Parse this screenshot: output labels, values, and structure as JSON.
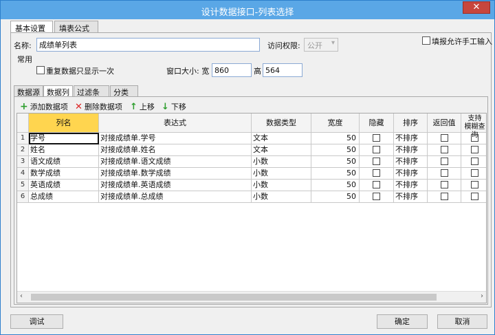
{
  "window": {
    "title": "设计数据接口-列表选择",
    "close": "✕"
  },
  "outer_tabs": [
    "基本设置",
    "填表公式"
  ],
  "form": {
    "name_label": "名称:",
    "name_value": "成绩单列表",
    "access_label": "访问权限:",
    "access_value": "公开",
    "allow_manual_label": "填报允许手工输入",
    "section_common": "常用",
    "repeat_once_label": "重复数据只显示一次",
    "window_size_label": "窗口大小: 宽",
    "width_value": "860",
    "height_label": "高",
    "height_value": "564"
  },
  "inner_tabs": [
    "数据源",
    "数据列",
    "过滤条件",
    "分类树"
  ],
  "toolbar": {
    "add": "添加数据项",
    "delete": "删除数据项",
    "up": "上移",
    "down": "下移"
  },
  "grid": {
    "headers": [
      "列名",
      "表达式",
      "数据类型",
      "宽度",
      "隐藏",
      "排序",
      "返回值"
    ],
    "header_last_line1": "支持",
    "header_last_line2": "模糊查询",
    "rows": [
      {
        "n": "1",
        "name": "学号",
        "expr": "对接成绩单.学号",
        "type": "文本",
        "width": "50",
        "sort": "不排序"
      },
      {
        "n": "2",
        "name": "姓名",
        "expr": "对接成绩单.姓名",
        "type": "文本",
        "width": "50",
        "sort": "不排序"
      },
      {
        "n": "3",
        "name": "语文成绩",
        "expr": "对接成绩单.语文成绩",
        "type": "小数",
        "width": "50",
        "sort": "不排序"
      },
      {
        "n": "4",
        "name": "数学成绩",
        "expr": "对接成绩单.数学成绩",
        "type": "小数",
        "width": "50",
        "sort": "不排序"
      },
      {
        "n": "5",
        "name": "英语成绩",
        "expr": "对接成绩单.英语成绩",
        "type": "小数",
        "width": "50",
        "sort": "不排序"
      },
      {
        "n": "6",
        "name": "总成绩",
        "expr": "对接成绩单.总成绩",
        "type": "小数",
        "width": "50",
        "sort": "不排序"
      }
    ]
  },
  "buttons": {
    "debug": "调试",
    "ok": "确定",
    "cancel": "取消"
  },
  "colors": {
    "titlebar": "#5aa7e6",
    "close": "#c7463d",
    "header_selected": "#ffd54f"
  }
}
